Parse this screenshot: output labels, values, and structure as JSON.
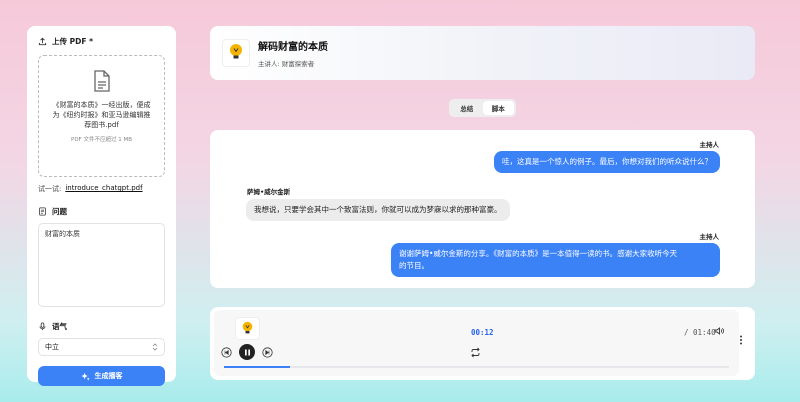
{
  "sidebar": {
    "upload_label": "上传 PDF *",
    "upload_file_text": "《财富的本质》一经出版，便成为《纽约时报》和亚马逊编辑推荐图书.pdf",
    "upload_limit": "PDF 文件不应超过 1 MB",
    "try_label": "试一试:",
    "try_link": "introduce_chatgpt.pdf",
    "question_label": "问题",
    "question_value": "财富的本质",
    "tone_label": "语气",
    "tone_value": "中立",
    "generate_label": "生成播客"
  },
  "header": {
    "title": "解码财富的本质",
    "subtitle": "主讲人: 财富探索者"
  },
  "tabs": [
    {
      "label": "总结",
      "active": false
    },
    {
      "label": "脚本",
      "active": true
    }
  ],
  "chat": [
    {
      "speaker": "主持人",
      "role": "host",
      "text": "哇，这真是一个惊人的例子。最后，你想对我们的听众说什么？"
    },
    {
      "speaker": "萨姆•威尔金斯",
      "role": "guest",
      "text": "我想说，只要学会其中一个致富法则，你就可以成为梦寐以求的那种富豪。"
    },
    {
      "speaker": "主持人",
      "role": "host",
      "text_line1": "谢谢萨姆•威尔金斯的分享。《财富的本质》是一本值得一读的书。感谢大家收听今天",
      "text_line2": "的节目。"
    }
  ],
  "player": {
    "current_time": "00:12",
    "total_time": "/ 01:40",
    "progress": 0.13
  },
  "colors": {
    "accent": "#3b82f6"
  }
}
